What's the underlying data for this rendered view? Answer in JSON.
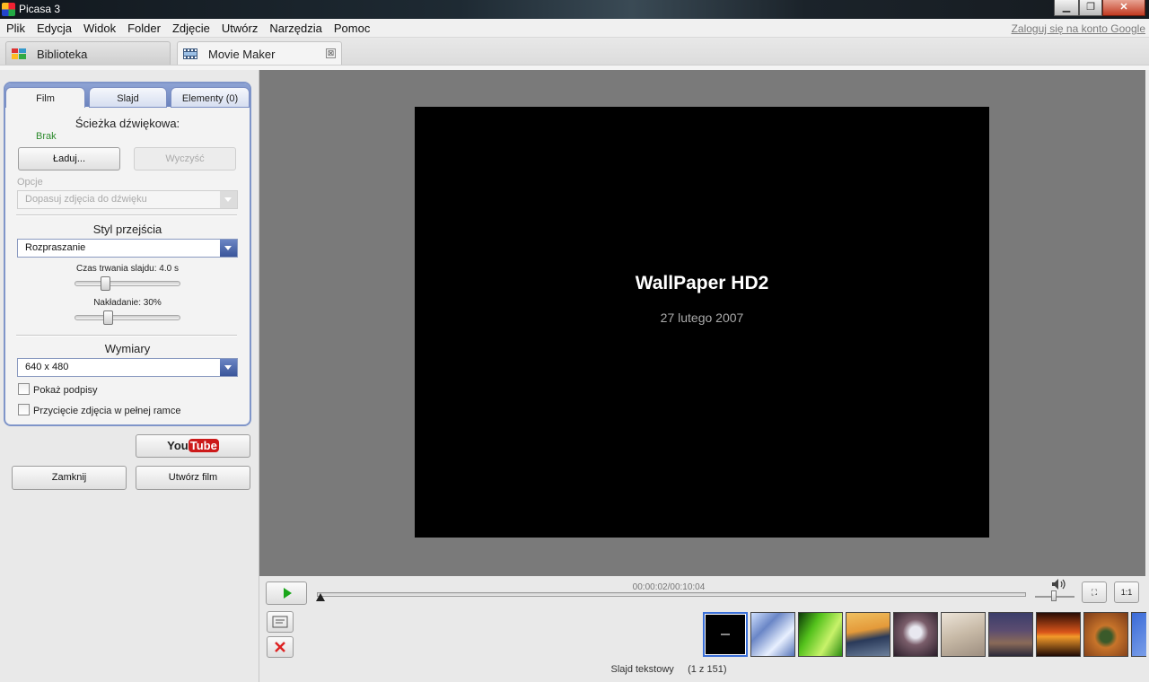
{
  "window": {
    "title": "Picasa 3"
  },
  "menubar": {
    "items": [
      "Plik",
      "Edycja",
      "Widok",
      "Folder",
      "Zdjęcie",
      "Utwórz",
      "Narzędzia",
      "Pomoc"
    ],
    "google_link": "Zaloguj się na konto Google"
  },
  "tabs": {
    "library": "Biblioteka",
    "movie_maker": "Movie Maker",
    "close_glyph": "⊠"
  },
  "panel": {
    "tabs": [
      "Film",
      "Slajd",
      "Elementy (0)"
    ],
    "soundtrack_title": "Ścieżka dźwiękowa:",
    "soundtrack_value": "Brak",
    "load_label": "Ładuj...",
    "clear_label": "Wyczyść",
    "options_label": "Opcje",
    "options_select": "Dopasuj zdjęcia do dźwięku",
    "transition_title": "Styl przejścia",
    "transition_select": "Rozpraszanie",
    "duration_label": "Czas trwania slajdu: 4.0 s",
    "duration_value": 4.0,
    "overlap_label": "Nakładanie: 30%",
    "overlap_value": 30,
    "dimensions_title": "Wymiary",
    "dimensions_select": "640 x 480",
    "show_captions": "Pokaż podpisy",
    "full_frame_crop": "Przycięcie zdjęcia w pełnej ramce"
  },
  "buttons": {
    "youtube_you": "You",
    "youtube_tube": "Tube",
    "close": "Zamknij",
    "create_movie": "Utwórz film"
  },
  "slide": {
    "title": "WallPaper HD2",
    "subtitle": "27 lutego 2007"
  },
  "player": {
    "time": "00:00:02/00:10:04",
    "progress_fraction": 0.003,
    "view_fit": "⛶",
    "view_1to1": "1:1"
  },
  "status": {
    "label": "Slajd tekstowy",
    "count": "(1 z 151)"
  },
  "colors": {
    "accent": "#3a559a",
    "green": "#2e8b2e",
    "play": "#1aa61a",
    "youtube_red": "#cc1a1a"
  },
  "filmstrip": [
    {
      "name": "text-slide-thumb",
      "selected": true,
      "bg": "#000"
    },
    {
      "name": "blue-waves-thumb",
      "bg": "linear-gradient(135deg,#cfe0ff,#6a86c6,#e8f0ff,#5573b8)"
    },
    {
      "name": "green-leaf-thumb",
      "bg": "linear-gradient(120deg,#0c3a08,#54c21c,#c8f26a,#2a8a10)"
    },
    {
      "name": "mountain-sunset-thumb",
      "bg": "linear-gradient(170deg,#f0c060,#e49a3a 40%,#2a3a5a 60%,#6c7f9a)"
    },
    {
      "name": "airplane-thumb",
      "bg": "radial-gradient(circle at 50% 45%,#e8e8f0 0 18%,#7a5d6a 40%,#2b1e2a)"
    },
    {
      "name": "sky-plane-thumb",
      "bg": "linear-gradient(160deg,#ece4d8,#c7b9a6,#9d8e80)"
    },
    {
      "name": "coast-dusk-thumb",
      "bg": "linear-gradient(180deg,#3b3e6a,#5b4c70 40%,#8a6a58 70%,#2b2a3a)"
    },
    {
      "name": "orange-sunset-thumb",
      "bg": "linear-gradient(180deg,#2a0d05,#d9551a 45%,#f39a2a 55%,#200a05)"
    },
    {
      "name": "canyon-river-thumb",
      "bg": "radial-gradient(circle at 50% 55%,#3a5a2a 0 18%,#c8742a 35%,#7a3a18)"
    },
    {
      "name": "partial-blue-thumb",
      "bg": "linear-gradient(135deg,#3a6ad8,#9ab8f0)"
    }
  ]
}
